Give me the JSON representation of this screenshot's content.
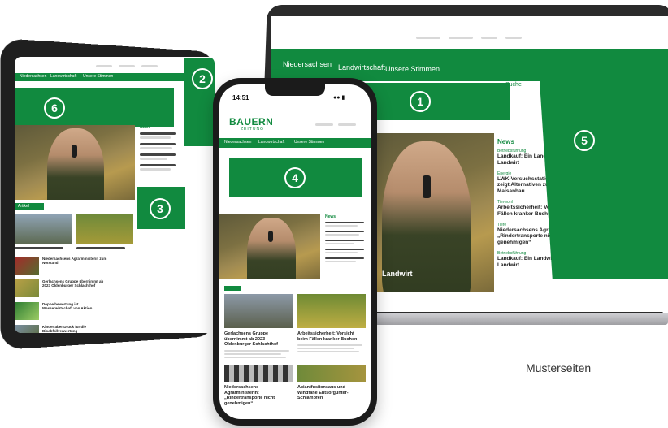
{
  "laptop": {
    "nav": [
      "Niedersachsen",
      "Landwirtschaft",
      "Unsere Stimmen"
    ],
    "search_label": "Suche",
    "news_heading": "News",
    "news_items": [
      {
        "kicker": "Betriebsführung",
        "title": "Landkauf: Ein Landwirt ist ein Landwirt"
      },
      {
        "kicker": "Energie",
        "title": "LWK-Versuchsstation Poppenburg zeigt Alternativen zum reinen Maisanbau"
      },
      {
        "kicker": "Tierwohl",
        "title": "Arbeitssicherheit: Vorsicht beim Fällen kranker Buchen"
      },
      {
        "kicker": "Tiere",
        "title": "Niedersachsens Agrarministerin: „Rindertransporte nicht genehmigen“"
      },
      {
        "kicker": "Betriebsführung",
        "title": "Landkauf: Ein Landwirt ist ein Landwirt"
      }
    ],
    "hero_caption": "Landwirt"
  },
  "phone": {
    "time": "14:51",
    "logo_top": "BAUERN",
    "logo_bottom": "ZEITUNG",
    "nav": [
      "Niedersachsen",
      "Landwirtschaft",
      "Unsere Stimmen"
    ],
    "news_heading": "News",
    "articles": [
      {
        "title": "Gerlachsens Gruppe übernimmt ab 2023 Oldenburger Schlachthof"
      },
      {
        "title": "Arbeitssicherheit: Vorsicht beim Fällen kranker Buchen"
      },
      {
        "title": "Niedersachsens Agrarministerin: „Rindertransporte nicht genehmigen“"
      },
      {
        "title": "Aciantfusiionsaus und Windfahe Entsorgunter-Schlämpfen"
      }
    ]
  },
  "tablet": {
    "nav": [
      "Niedersachsen",
      "Landwirtschaft",
      "Unsere Stimmen"
    ],
    "news_heading": "News",
    "section_label": "Artikel",
    "list_items": [
      {
        "title": "Niedersachsens Agrarministerin zum Notstand"
      },
      {
        "title": "Gerlachsens Gruppe übernimmt ab 2023 Oldenburger Schlachthof"
      },
      {
        "title": "Doppelbewertung ist Wasserwirtschaft von Aktion"
      },
      {
        "title": "Kinder aber Druck für die Bioabfallverwertung"
      }
    ]
  },
  "badges": [
    "1",
    "2",
    "3",
    "4",
    "5",
    "6"
  ],
  "caption": "Musterseiten",
  "colors": {
    "brand_green": "#118a3f",
    "dark_green": "#0f6e31"
  }
}
